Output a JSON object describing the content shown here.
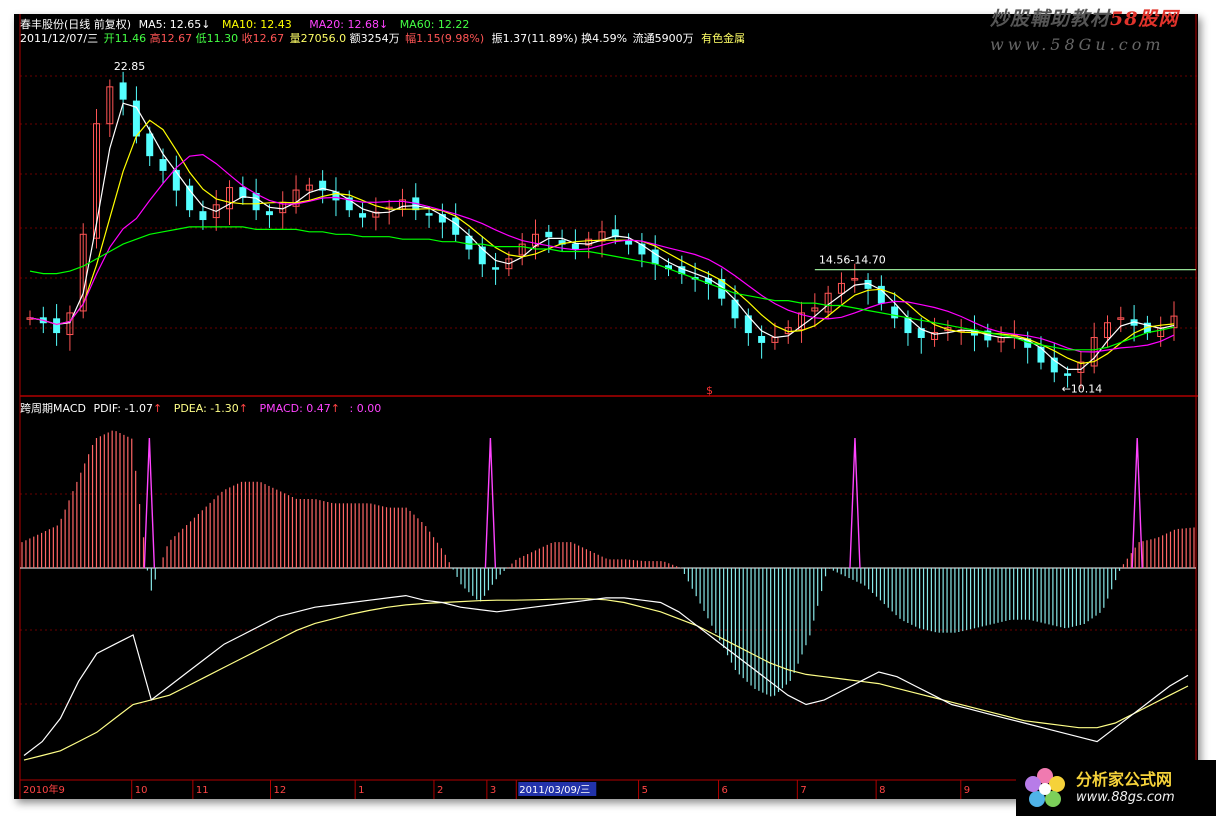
{
  "header": {
    "stock_name": "春丰股份(日线 前复权)",
    "ma5": "MA5: 12.65↓",
    "ma10": "MA10: 12.43",
    "ma20": "MA20: 12.68↓",
    "ma60": "MA60: 12.22",
    "date": "2011/12/07/三",
    "open": "开11.46",
    "high": "高12.67",
    "low": "低11.30",
    "close": "收12.67",
    "volume": "量27056.0",
    "amount": "额3254万",
    "change": "幅1.15(9.98%)",
    "amplitude": "振1.37(11.89%)",
    "turnover": "换4.59%",
    "float": "流通5900万",
    "sector": "有色金属"
  },
  "indicator": {
    "name": "跨周期MACD",
    "pdif": "PDIF: -1.07",
    "pdea": "PDEA: -1.30",
    "pmacd": "PMACD: 0.47",
    "extra": ": 0.00",
    "arrow": "↑"
  },
  "annotations": {
    "high_label": "22.85",
    "low_label": "←10.14",
    "range_label": "14.56-14.70",
    "marker": "$"
  },
  "axis": {
    "labels": [
      "2010年9",
      "10",
      "11",
      "12",
      "1",
      "2",
      "3",
      "2011/03/09/三",
      "5",
      "6",
      "7",
      "8",
      "9"
    ]
  },
  "watermarks": {
    "top_line1": "炒股輔助教材",
    "top_line1_red": "58股网",
    "top_line2": "www.58Gu.com",
    "bottom_line1": "分析家公式网",
    "bottom_line2": "www.88gs.com"
  },
  "colors": {
    "up": "#ff5555",
    "down": "#55ffff",
    "ma5": "#ffffff",
    "ma10": "#ffff00",
    "ma20": "#ff00ff",
    "ma60": "#00ff00",
    "pdif": "#ffffff",
    "pdea": "#ffff88",
    "pos_bar": "#ff6666",
    "neg_bar": "#88e8e8",
    "spike": "#ff44ff",
    "axis": "#b00000"
  },
  "chart_data": {
    "type": "candlestick+macd",
    "price_panel": {
      "close_series": [
        12.6,
        12.4,
        12.0,
        12.8,
        16.0,
        20.5,
        22.0,
        21.5,
        20.0,
        19.2,
        18.6,
        17.8,
        17.0,
        16.6,
        17.2,
        17.9,
        17.5,
        17.0,
        16.8,
        17.3,
        17.8,
        18.0,
        17.8,
        17.4,
        17.0,
        16.7,
        16.9,
        17.1,
        17.4,
        17.0,
        16.8,
        16.5,
        16.0,
        15.4,
        14.8,
        14.6,
        15.0,
        15.6,
        16.0,
        15.9,
        15.6,
        15.4,
        15.8,
        16.1,
        15.9,
        15.6,
        15.2,
        14.8,
        14.6,
        14.4,
        14.2,
        14.0,
        13.4,
        12.6,
        12.0,
        11.6,
        11.8,
        12.2,
        12.8,
        13.0,
        13.6,
        14.0,
        14.2,
        13.8,
        13.2,
        12.6,
        12.0,
        11.8,
        12.0,
        12.2,
        12.1,
        11.9,
        11.7,
        11.8,
        11.9,
        11.4,
        10.8,
        10.4,
        10.3,
        10.8,
        11.8,
        12.4,
        12.6,
        12.3,
        12.0,
        12.2,
        12.67
      ],
      "ma60_series": [
        14.5,
        14.4,
        14.4,
        14.5,
        14.7,
        15.0,
        15.3,
        15.6,
        15.8,
        16.0,
        16.1,
        16.2,
        16.3,
        16.3,
        16.3,
        16.3,
        16.3,
        16.2,
        16.2,
        16.2,
        16.2,
        16.1,
        16.1,
        16.0,
        16.0,
        15.9,
        15.9,
        15.9,
        15.8,
        15.8,
        15.8,
        15.7,
        15.7,
        15.6,
        15.6,
        15.5,
        15.5,
        15.5,
        15.4,
        15.4,
        15.3,
        15.3,
        15.3,
        15.2,
        15.1,
        15.0,
        14.9,
        14.8,
        14.6,
        14.4,
        14.2,
        14.0,
        13.8,
        13.6,
        13.5,
        13.4,
        13.3,
        13.3,
        13.2,
        13.2,
        13.1,
        13.1,
        13.0,
        12.9,
        12.8,
        12.7,
        12.6,
        12.5,
        12.4,
        12.3,
        12.2,
        12.1,
        12.0,
        11.9,
        11.8,
        11.6,
        11.5,
        11.4,
        11.3,
        11.3,
        11.3,
        11.4,
        11.6,
        11.8,
        12.0,
        12.1,
        12.22
      ],
      "y_range": [
        9.5,
        23.5
      ],
      "high_point": 22.85,
      "low_point": 10.14,
      "range_line": 14.56
    },
    "macd_panel": {
      "pdif_series": [
        -2.8,
        -2.5,
        -2.0,
        -1.2,
        -0.6,
        -0.4,
        -0.2,
        -1.6,
        -1.3,
        -1.0,
        -0.7,
        -0.4,
        -0.2,
        0.0,
        0.2,
        0.3,
        0.4,
        0.45,
        0.5,
        0.55,
        0.6,
        0.65,
        0.55,
        0.5,
        0.4,
        0.35,
        0.3,
        0.35,
        0.4,
        0.45,
        0.5,
        0.55,
        0.6,
        0.6,
        0.55,
        0.5,
        0.3,
        0.0,
        -0.3,
        -0.6,
        -0.9,
        -1.2,
        -1.5,
        -1.7,
        -1.6,
        -1.4,
        -1.2,
        -1.0,
        -1.1,
        -1.3,
        -1.5,
        -1.7,
        -1.8,
        -1.9,
        -2.0,
        -2.1,
        -2.2,
        -2.3,
        -2.4,
        -2.5,
        -2.2,
        -1.9,
        -1.6,
        -1.3,
        -1.07
      ],
      "pdea_series": [
        -2.9,
        -2.8,
        -2.7,
        -2.5,
        -2.3,
        -2.0,
        -1.7,
        -1.6,
        -1.5,
        -1.3,
        -1.1,
        -0.9,
        -0.7,
        -0.5,
        -0.3,
        -0.1,
        0.05,
        0.15,
        0.25,
        0.33,
        0.4,
        0.45,
        0.48,
        0.5,
        0.52,
        0.54,
        0.55,
        0.55,
        0.56,
        0.57,
        0.58,
        0.58,
        0.56,
        0.5,
        0.4,
        0.3,
        0.15,
        0.0,
        -0.2,
        -0.4,
        -0.6,
        -0.8,
        -0.95,
        -1.05,
        -1.1,
        -1.15,
        -1.2,
        -1.25,
        -1.35,
        -1.45,
        -1.55,
        -1.65,
        -1.75,
        -1.85,
        -1.95,
        -2.05,
        -2.1,
        -2.15,
        -2.2,
        -2.2,
        -2.1,
        -1.9,
        -1.7,
        -1.5,
        -1.3
      ],
      "hist_series": [
        0.3,
        0.4,
        0.5,
        1.0,
        1.5,
        1.6,
        1.5,
        -0.3,
        0.3,
        0.5,
        0.7,
        0.9,
        1.0,
        1.0,
        0.9,
        0.8,
        0.8,
        0.75,
        0.75,
        0.75,
        0.7,
        0.7,
        0.5,
        0.2,
        -0.2,
        -0.4,
        -0.1,
        0.1,
        0.2,
        0.3,
        0.3,
        0.2,
        0.1,
        0.1,
        0.08,
        0.08,
        0.0,
        -0.4,
        -0.8,
        -1.2,
        -1.4,
        -1.5,
        -1.3,
        -0.8,
        0.0,
        -0.1,
        -0.2,
        -0.4,
        -0.6,
        -0.7,
        -0.75,
        -0.75,
        -0.7,
        -0.65,
        -0.6,
        -0.6,
        -0.65,
        -0.7,
        -0.65,
        -0.5,
        0.0,
        0.3,
        0.35,
        0.45,
        0.47
      ],
      "spike_positions": [
        0.11,
        0.4,
        0.71,
        0.95
      ]
    }
  }
}
